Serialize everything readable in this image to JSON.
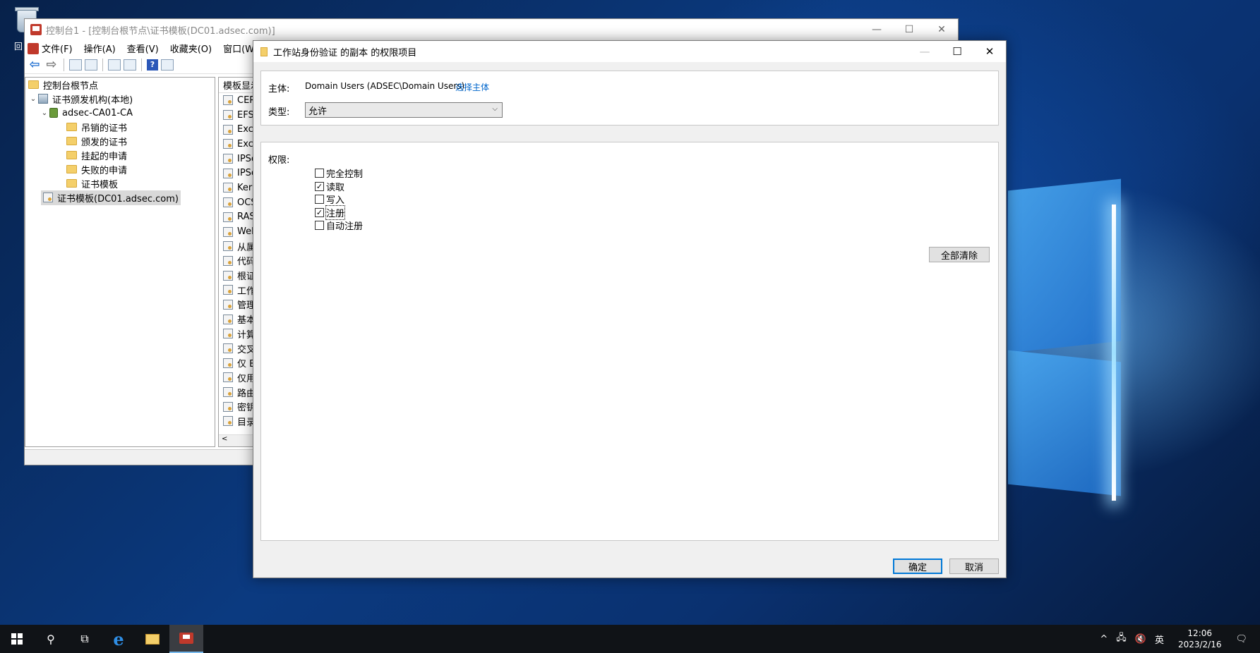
{
  "desktop": {
    "recycle_label": "回"
  },
  "mmc": {
    "title": "控制台1 - [控制台根节点\\证书模板(DC01.adsec.com)]",
    "menu": [
      "文件(F)",
      "操作(A)",
      "查看(V)",
      "收藏夹(O)",
      "窗口(W)"
    ],
    "tree": [
      {
        "label": "控制台根节点",
        "level": 0,
        "icon": "folder-icon"
      },
      {
        "label": "证书颁发机构(本地)",
        "level": 0,
        "icon": "ca-icon",
        "expanded": true
      },
      {
        "label": "adsec-CA01-CA",
        "level": 1,
        "icon": "server-icon",
        "expanded": true
      },
      {
        "label": "吊销的证书",
        "level": 2,
        "icon": "folder-icon"
      },
      {
        "label": "颁发的证书",
        "level": 2,
        "icon": "folder-icon"
      },
      {
        "label": "挂起的申请",
        "level": 2,
        "icon": "folder-icon"
      },
      {
        "label": "失败的申请",
        "level": 2,
        "icon": "folder-icon"
      },
      {
        "label": "证书模板",
        "level": 2,
        "icon": "folder-icon"
      },
      {
        "label": "证书模板(DC01.adsec.com)",
        "level": 0,
        "icon": "template-icon",
        "selected": true
      }
    ],
    "list_header": "模板显示",
    "list_items": [
      "CEP",
      "EFS",
      "Exch",
      "Exch",
      "IPSe",
      "IPSe",
      "Kerb",
      "OCS",
      "RAS",
      "Web",
      "从属",
      "代码",
      "根证",
      "工作",
      "管理",
      "基本",
      "计算",
      "交叉",
      "仅 E",
      "仅用",
      "路由",
      "密钥",
      "目录"
    ],
    "scroll_left": "<"
  },
  "dialog": {
    "title": "工作站身份验证 的副本 的权限项目",
    "principal_label": "主体:",
    "principal_value": "Domain Users (ADSEC\\Domain Users)",
    "select_principal_link": "选择主体",
    "type_label": "类型:",
    "type_value": "允许",
    "permissions_label": "权限:",
    "permissions": [
      {
        "label": "完全控制",
        "checked": false
      },
      {
        "label": "读取",
        "checked": true
      },
      {
        "label": "写入",
        "checked": false
      },
      {
        "label": "注册",
        "checked": true,
        "focused": true
      },
      {
        "label": "自动注册",
        "checked": false
      }
    ],
    "clear_all_button": "全部清除",
    "ok_button": "确定",
    "cancel_button": "取消"
  },
  "taskbar": {
    "ime": "英",
    "time": "12:06",
    "date": "2023/2/16"
  }
}
